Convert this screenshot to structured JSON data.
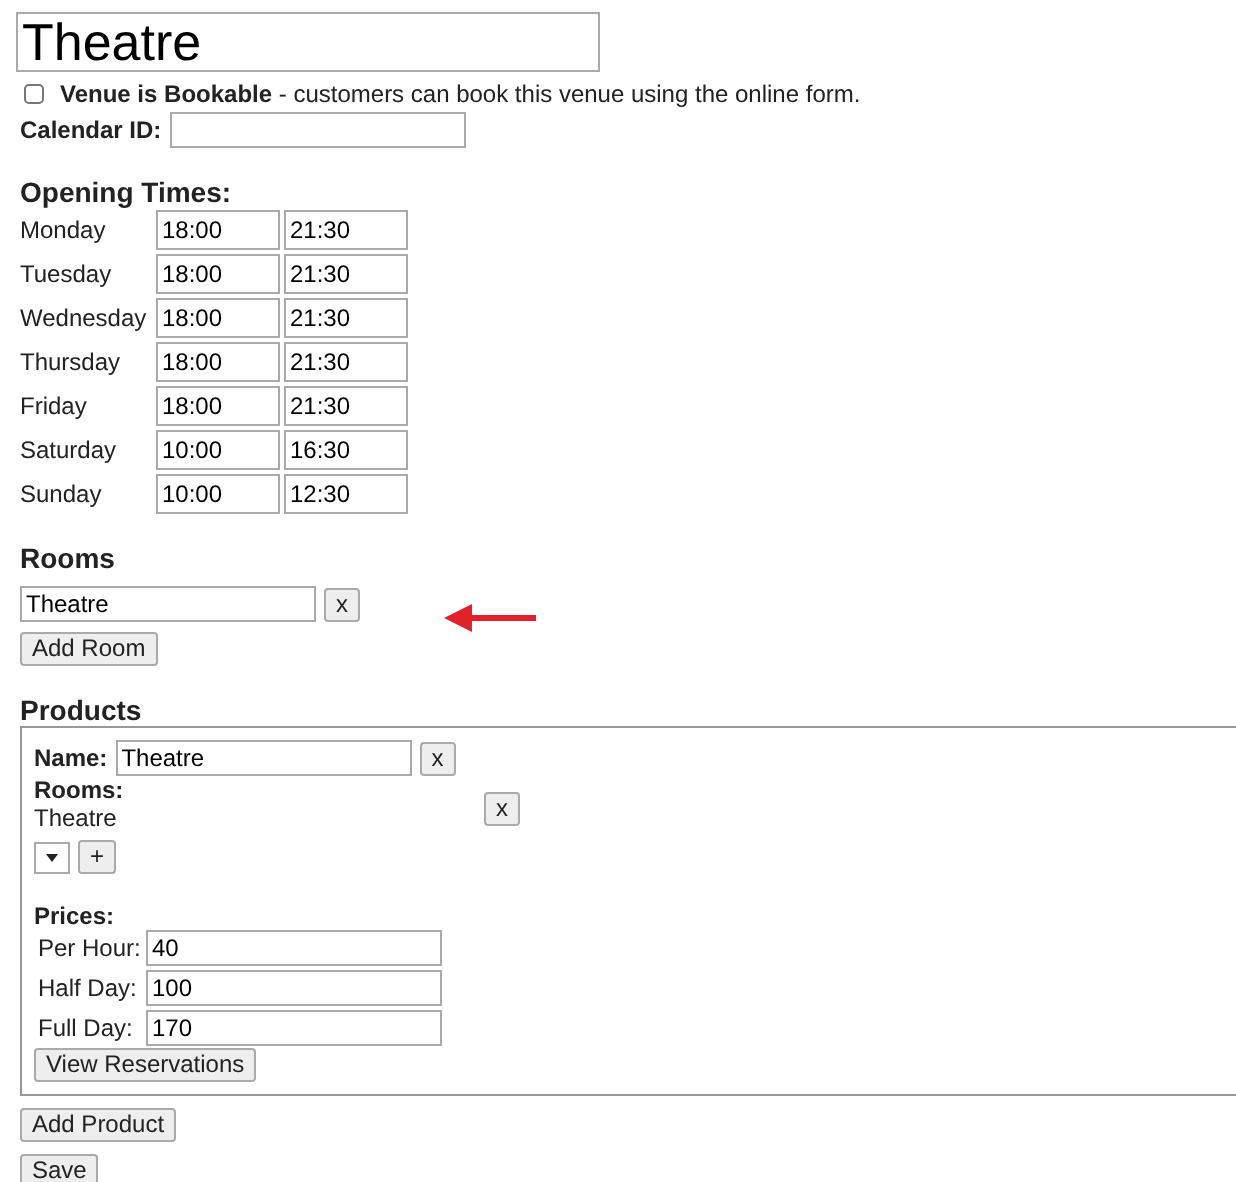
{
  "venue_name": "Theatre",
  "bookable": {
    "checked": false,
    "label": "**Venue is Bookable** - customers can book this venue using the online form."
  },
  "calendar": {
    "label": "Calendar ID:"
  },
  "opening_times": {
    "heading": "Opening Times:",
    "days": [
      {
        "day": "Monday",
        "open": "18:00",
        "close": "21:30"
      },
      {
        "day": "Tuesday",
        "open": "18:00",
        "close": "21:30"
      },
      {
        "day": "Wednesday",
        "open": "18:00",
        "close": "21:30"
      },
      {
        "day": "Thursday",
        "open": "18:00",
        "close": "21:30"
      },
      {
        "day": "Friday",
        "open": "18:00",
        "close": "21:30"
      },
      {
        "day": "Saturday",
        "open": "10:00",
        "close": "16:30"
      },
      {
        "day": "Sunday",
        "open": "10:00",
        "close": "12:30"
      }
    ]
  },
  "rooms": {
    "heading": "Rooms",
    "items": [
      {
        "value": "Theatre",
        "remove": "x"
      }
    ],
    "add_button": "Add Room"
  },
  "products": {
    "heading": "Products",
    "items": [
      {
        "name_label": "Name:",
        "name": "Theatre",
        "remove": "x",
        "rooms_label": "Rooms:",
        "rooms": [
          {
            "name": "Theatre",
            "remove": "x"
          }
        ],
        "add_room": "+",
        "prices_label": "Prices:",
        "prices": [
          {
            "label": "Per Hour:",
            "value": "40"
          },
          {
            "label": "Half Day:",
            "value": "100"
          },
          {
            "label": "Full Day:",
            "value": "170"
          }
        ],
        "reservations_button": "View Reservations"
      }
    ],
    "add_button": "Add Product"
  },
  "save_button": "Save"
}
